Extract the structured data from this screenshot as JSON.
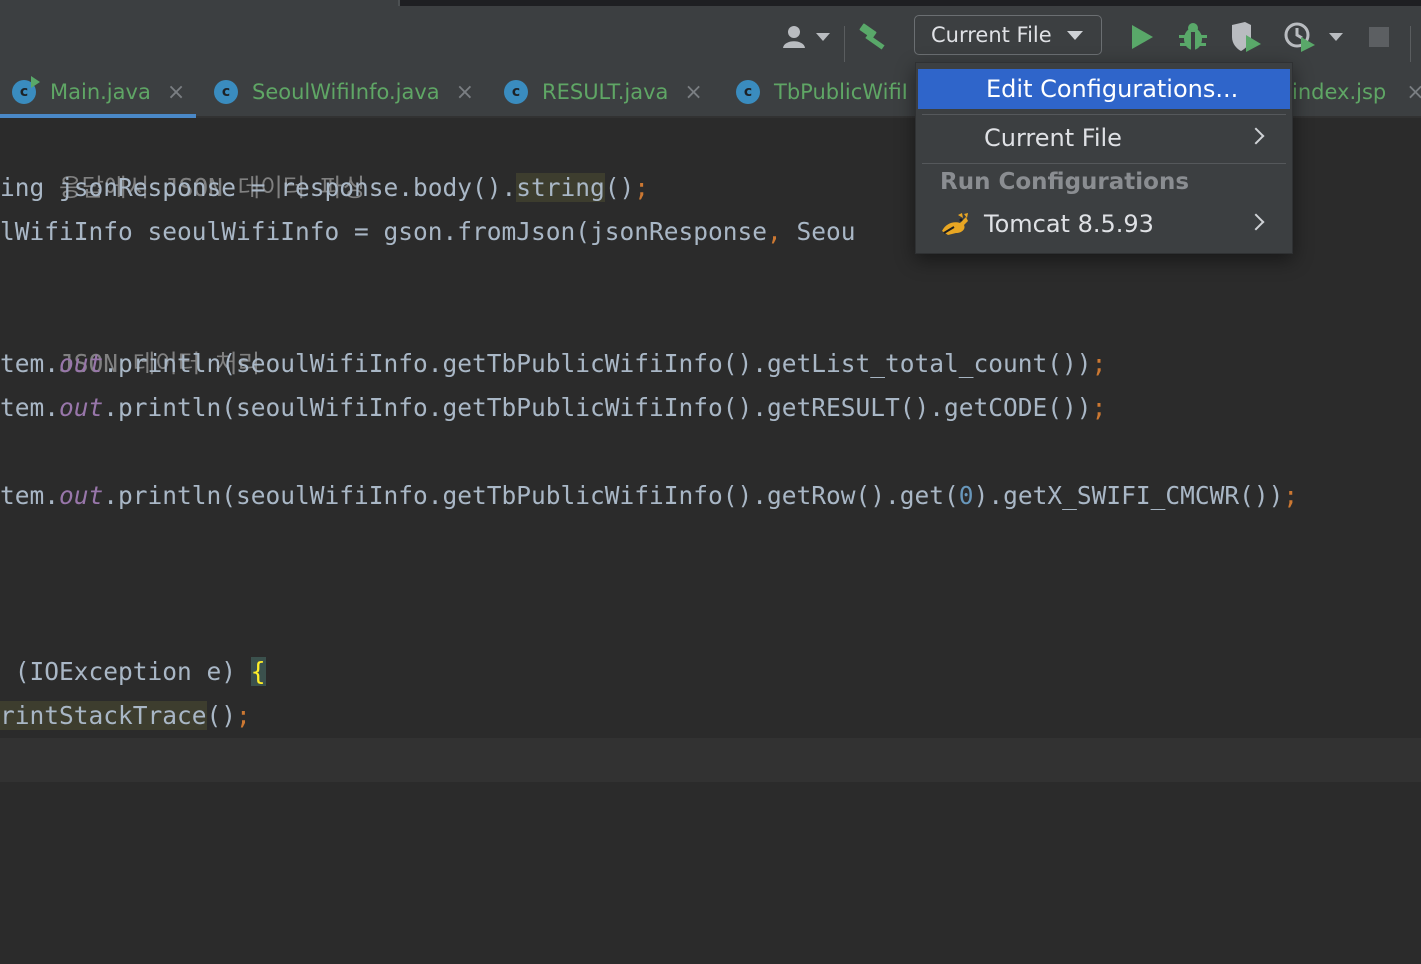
{
  "toolbar": {
    "run_config_label": "Current File",
    "accent_run": "#59a869"
  },
  "tabs": [
    {
      "label": "Main.java",
      "icon": "class-icon",
      "active": true
    },
    {
      "label": "SeoulWifiInfo.java",
      "icon": "class-icon"
    },
    {
      "label": "RESULT.java",
      "icon": "class-icon"
    },
    {
      "label": "TbPublicWifiI",
      "icon": "class-icon"
    },
    {
      "label": "index.jsp",
      "icon": "jsp-icon"
    }
  ],
  "icon_letter": "c",
  "close_glyph": "×",
  "code": {
    "l1_comment": "응답에서 JSON 데이터 파싱",
    "l2_a": "ing jsonResponse = response.body().",
    "l2_b": "string",
    "l2_c": "()",
    "l2_d": ";",
    "l3_a": "lWifiInfo seoulWifiInfo = gson.fromJson(jsonResponse",
    "l3_b": ",",
    "l3_c": " Seou",
    "l5_comment": "JSON 데이터 처리",
    "l6_a": "tem.",
    "l6_b": "out",
    "l6_c": ".println(seoulWifiInfo.getTbPublicWifiInfo().getList_total_count())",
    "l6_d": ";",
    "l7_a": "tem.",
    "l7_b": "out",
    "l7_c": ".println(seoulWifiInfo.getTbPublicWifiInfo().getRESULT().getCODE())",
    "l7_d": ";",
    "l9_a": "tem.",
    "l9_b": "out",
    "l9_c": ".println(seoulWifiInfo.getTbPublicWifiInfo().getRow().get(",
    "l9_n": "0",
    "l9_e": ").getX_SWIFI_CMCWR())",
    "l9_d": ";",
    "l13_a": " (IOException e) ",
    "l13_b": "{",
    "l14_a": "rintStackTrace",
    "l14_b": "()",
    "l14_c": ";"
  },
  "popup": {
    "edit_configurations": "Edit Configurations...",
    "current_file": "Current File",
    "run_configurations_header": "Run Configurations",
    "tomcat": "Tomcat 8.5.93"
  }
}
